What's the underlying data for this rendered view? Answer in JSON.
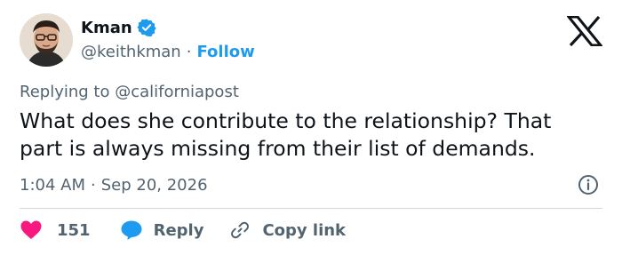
{
  "author": {
    "name": "Kman",
    "handle": "@keithkman",
    "separator": "·",
    "follow_label": "Follow"
  },
  "reply_to": "Replying to @californiapost",
  "tweet": {
    "text_line1": "What does she contribute to the relationship? That",
    "text_line2": "part is always missing from their list of demands."
  },
  "meta": {
    "time": "1:04 AM",
    "separator": "·",
    "date": "Sep 20, 2026"
  },
  "actions": {
    "likes": "151",
    "reply_label": "Reply",
    "copy_link_label": "Copy link"
  },
  "colors": {
    "accent": "#1d9bf0",
    "like": "#f91880",
    "text": "#0f1419",
    "secondary": "#536471"
  },
  "icons": [
    "verified-badge-icon",
    "x-logo-icon",
    "info-icon",
    "heart-icon",
    "reply-bubble-icon",
    "link-icon"
  ]
}
